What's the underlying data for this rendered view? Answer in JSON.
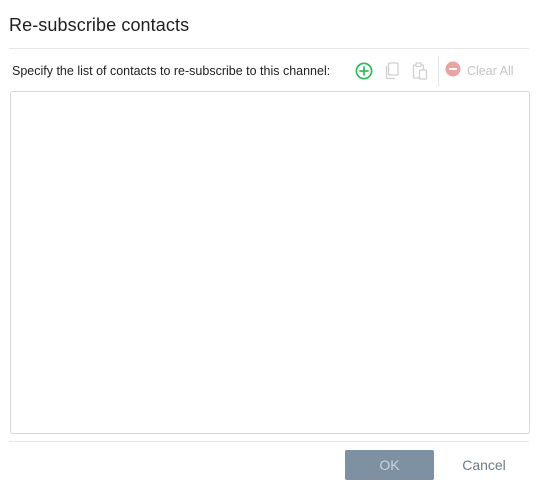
{
  "dialog": {
    "title": "Re-subscribe contacts",
    "instruction": "Specify the list of contacts to re-subscribe to this channel:"
  },
  "toolbar": {
    "add_icon": "plus-circle-icon",
    "copy_icon": "copy-icon",
    "paste_icon": "paste-icon",
    "clear_icon": "minus-circle-icon",
    "clear_all_label": "Clear All"
  },
  "contacts_list": {
    "items": []
  },
  "footer": {
    "ok_label": "OK",
    "cancel_label": "Cancel"
  },
  "colors": {
    "add_icon": "#2ebd59",
    "disabled_icon": "#cfcfcf",
    "clear_icon": "#e8a3a3",
    "ok_bg": "#7d91a3",
    "cancel_text": "#6b7b8a"
  }
}
